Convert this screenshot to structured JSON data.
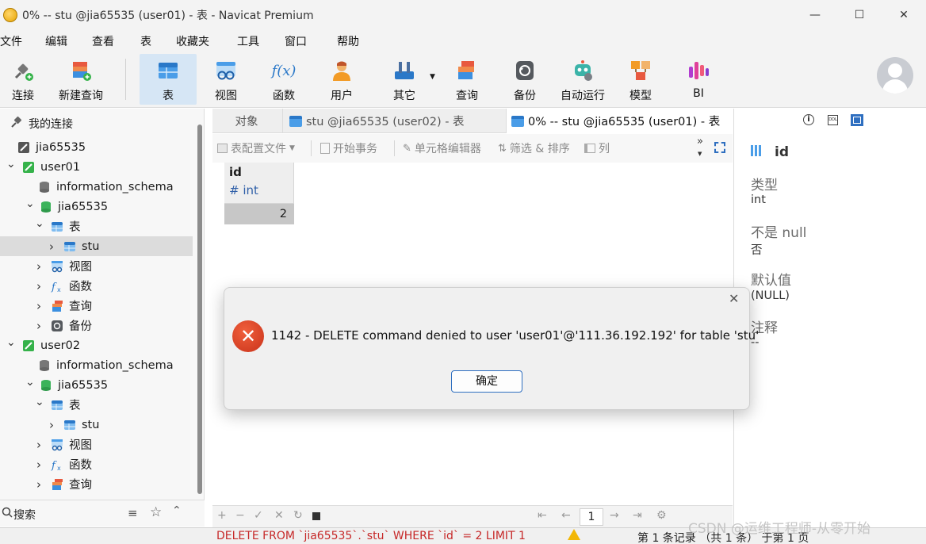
{
  "window": {
    "title": "0% -- stu @jia65535 (user01) - 表 - Navicat Premium",
    "minimize": "—",
    "maximize": "☐",
    "close": "✕"
  },
  "menu": [
    "文件",
    "编辑",
    "查看",
    "表",
    "收藏夹",
    "工具",
    "窗口",
    "帮助"
  ],
  "toolbar": {
    "connect": "连接",
    "new_query": "新建查询",
    "table": "表",
    "view": "视图",
    "function": "函数",
    "function_glyph": "f(x)",
    "user": "用户",
    "other": "其它",
    "query": "查询",
    "backup": "备份",
    "automation": "自动运行",
    "model": "模型",
    "bi": "BI"
  },
  "navigator": {
    "title": "我的连接",
    "tree": [
      {
        "label": "jia65535",
        "level": 0,
        "icon": "connection-off-icon"
      },
      {
        "label": "user01",
        "level": 0,
        "icon": "connection-on-icon",
        "expanded": true
      },
      {
        "label": "information_schema",
        "level": 1,
        "icon": "database-gray-icon"
      },
      {
        "label": "jia65535",
        "level": 1,
        "icon": "database-green-icon",
        "expanded": true
      },
      {
        "label": "表",
        "level": 2,
        "icon": "table-icon",
        "expanded": true
      },
      {
        "label": "stu",
        "level": 3,
        "icon": "table-icon",
        "selected": true
      },
      {
        "label": "视图",
        "level": 2,
        "icon": "view-icon"
      },
      {
        "label": "函数",
        "level": 2,
        "icon": "function-icon"
      },
      {
        "label": "查询",
        "level": 2,
        "icon": "query-icon"
      },
      {
        "label": "备份",
        "level": 2,
        "icon": "backup-icon"
      },
      {
        "label": "user02",
        "level": 0,
        "icon": "connection-on-icon",
        "expanded": true
      },
      {
        "label": "information_schema",
        "level": 1,
        "icon": "database-gray-icon"
      },
      {
        "label": "jia65535",
        "level": 1,
        "icon": "database-green-icon",
        "expanded": true
      },
      {
        "label": "表",
        "level": 2,
        "icon": "table-icon",
        "expanded": true
      },
      {
        "label": "stu",
        "level": 3,
        "icon": "table-icon"
      },
      {
        "label": "视图",
        "level": 2,
        "icon": "view-icon"
      },
      {
        "label": "函数",
        "level": 2,
        "icon": "function-icon"
      },
      {
        "label": "查询",
        "level": 2,
        "icon": "query-icon"
      }
    ],
    "search_placeholder": "搜索"
  },
  "tabs": [
    "对象",
    "stu @jia65535 (user02) - 表",
    "0% -- stu @jia65535 (user01) - 表"
  ],
  "object_toolbar": {
    "table_profile": "表配置文件",
    "begin_transaction": "开始事务",
    "cell_editor": "单元格编辑器",
    "filter_sort": "筛选 & 排序",
    "columns": "列"
  },
  "grid": {
    "column_name": "id",
    "column_type": "# int",
    "rows": [
      "2"
    ],
    "page": "1"
  },
  "info_pane": {
    "field_name": "id",
    "type_label": "类型",
    "type_value": "int",
    "notnull_label": "不是 null",
    "notnull_value": "否",
    "default_label": "默认值",
    "default_value": "(NULL)",
    "comment_label": "注释",
    "comment_value": "--"
  },
  "dialog": {
    "message": "1142 - DELETE command denied to user 'user01'@'111.36.192.192' for table 'stu'",
    "ok_label": "确定",
    "close": "✕"
  },
  "statusbar": {
    "sql": "DELETE FROM `jia65535`.`stu` WHERE `id` = 2 LIMIT 1",
    "records": "第 1 条记录 （共 1 条） 于第 1 页",
    "watermark": "CSDN @运维工程师-从零开始"
  },
  "colors": {
    "accent": "#2f6fc0",
    "error": "#c62828",
    "selection": "#dcdcdc"
  }
}
